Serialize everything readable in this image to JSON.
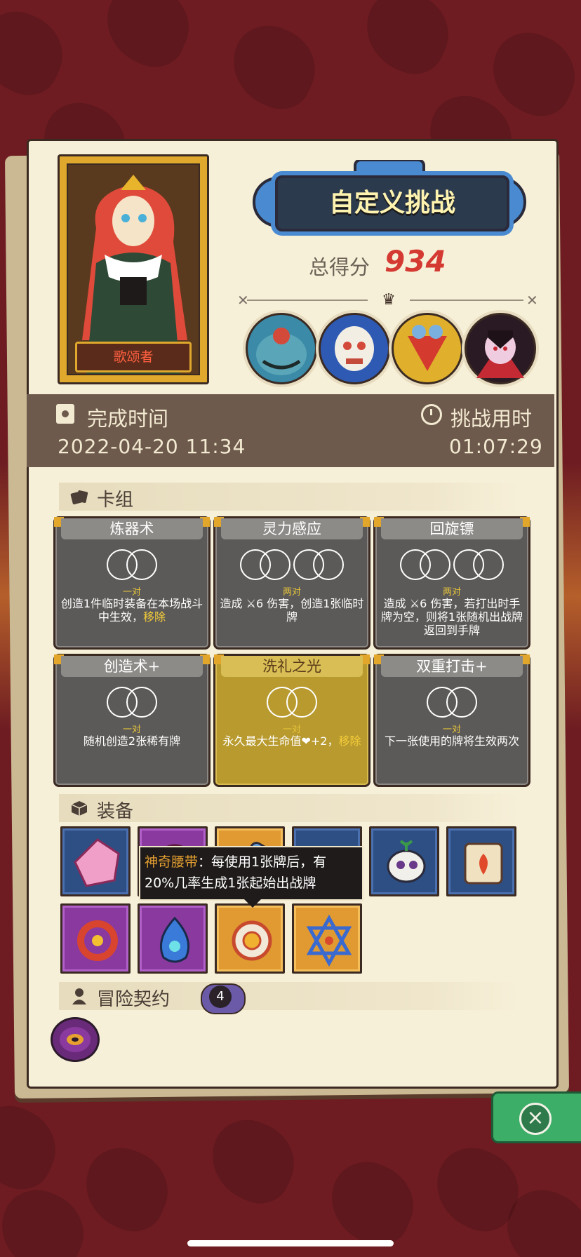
{
  "hero": {
    "name": "歌颂者"
  },
  "header": {
    "title": "自定义挑战",
    "score_label": "总得分",
    "score_value": "934"
  },
  "bosses": [
    "boss-toad",
    "boss-skull-mask",
    "boss-beetle",
    "boss-vampire"
  ],
  "times": {
    "completion_label": "完成时间",
    "completion_value": "2022-04-20 11:34",
    "duration_label": "挑战用时",
    "duration_value": "01:07:29"
  },
  "deck": {
    "title": "卡组",
    "cards": [
      {
        "name": "炼器术",
        "count": "一对",
        "desc": "创造1件临时装备在本场战斗中生效，",
        "tag": "移除",
        "tier": "gray"
      },
      {
        "name": "灵力感应",
        "count": "两对",
        "desc": "造成 ⚔6 伤害，创造1张临时牌",
        "tag": "",
        "tier": "gray"
      },
      {
        "name": "回旋镖",
        "count": "两对",
        "desc": "造成 ⚔6 伤害，若打出时手牌为空，则将1张随机出战牌返回到手牌",
        "tag": "",
        "tier": "gray"
      },
      {
        "name": "创造术+",
        "count": "一对",
        "desc": "随机创造2张稀有牌",
        "tag": "",
        "tier": "gray"
      },
      {
        "name": "洗礼之光",
        "count": "一对",
        "desc": "永久最大生命值❤+2，",
        "tag": "移除",
        "tier": "gold"
      },
      {
        "name": "双重打击+",
        "count": "一对",
        "desc": "下一张使用的牌将生效两次",
        "tag": "",
        "tier": "gray"
      }
    ]
  },
  "equipment": {
    "title": "装备",
    "items": [
      {
        "icon": "pink-crystal-icon",
        "color": "blue"
      },
      {
        "icon": "pink-orb-icon",
        "color": "purple"
      },
      {
        "icon": "potion-icon",
        "color": "orange"
      },
      {
        "icon": "green-gem-icon",
        "color": "blue"
      },
      {
        "icon": "skull-sprout-icon",
        "color": "blue"
      },
      {
        "icon": "fire-scroll-icon",
        "color": "blue"
      },
      {
        "icon": "spiked-bracelet-icon",
        "color": "purple"
      },
      {
        "icon": "blue-flame-icon",
        "color": "purple"
      },
      {
        "icon": "magic-belt-icon",
        "color": "orange"
      },
      {
        "icon": "hexagram-icon",
        "color": "orange"
      }
    ],
    "tooltip": {
      "name": "神奇腰带",
      "line1": "：每使用1张牌后，有",
      "line2": "20%几率生成1张起始出战牌"
    }
  },
  "contracts": {
    "title": "冒险契约",
    "count": "4"
  },
  "colors": {
    "background": "#6e1c22",
    "panel": "#f7f0d8",
    "score": "#d43a32",
    "highlight": "#f5cd3a"
  }
}
